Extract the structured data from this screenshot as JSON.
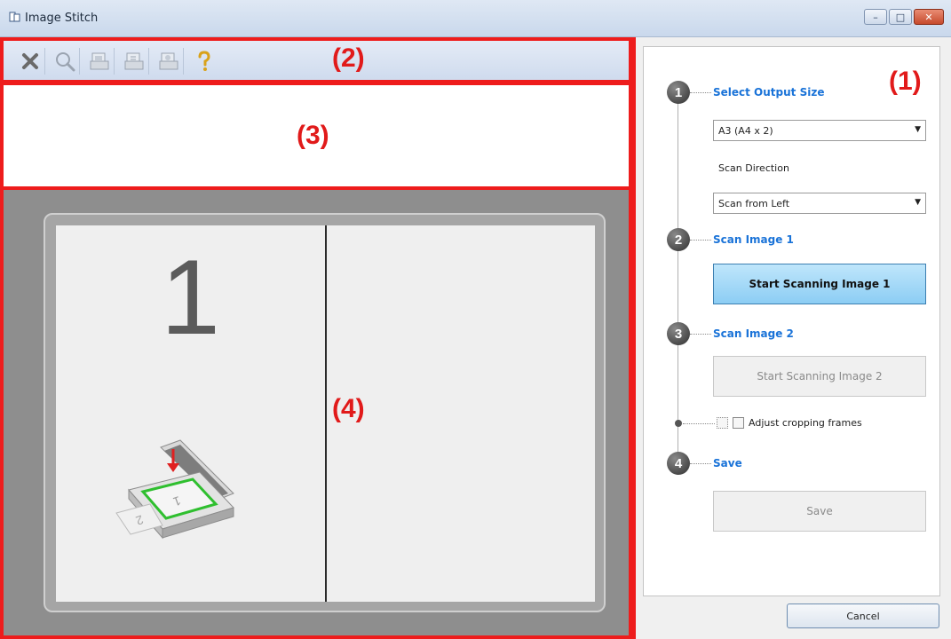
{
  "window": {
    "title": "Image Stitch",
    "minimize_glyph": "–",
    "maximize_glyph": "□",
    "close_glyph": "✕"
  },
  "toolbar": {
    "region_label": "(2)",
    "icons": [
      "delete-icon",
      "zoom-icon",
      "save-image-icon",
      "scan-image-icon",
      "print-image-icon",
      "help-icon"
    ]
  },
  "thumbnails": {
    "region_label": "(3)"
  },
  "preview": {
    "region_label": "(4)",
    "page1_number": "1"
  },
  "panel": {
    "region_label": "(1)",
    "step1": {
      "number": "1",
      "title": "Select Output Size"
    },
    "output_size": {
      "value": "A3 (A4 x 2)"
    },
    "scan_direction": {
      "label": "Scan Direction",
      "value": "Scan from Left"
    },
    "step2": {
      "number": "2",
      "title": "Scan Image 1",
      "button": "Start Scanning Image 1"
    },
    "step3": {
      "number": "3",
      "title": "Scan Image 2",
      "button": "Start Scanning Image 2"
    },
    "adjust": {
      "label": "Adjust cropping frames",
      "checked": false
    },
    "step4": {
      "number": "4",
      "title": "Save",
      "button": "Save"
    },
    "cancel": "Cancel"
  },
  "colors": {
    "highlight_red": "#ee1c1c",
    "step_title_blue": "#1a73d8",
    "active_button": "#8ccdf4"
  }
}
